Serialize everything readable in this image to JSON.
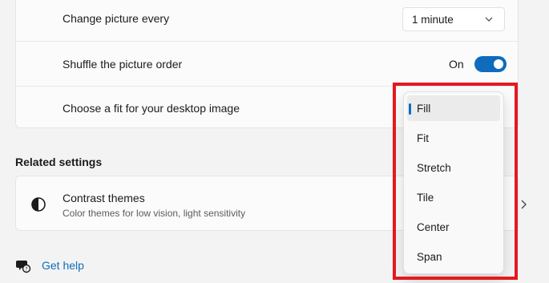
{
  "settings": {
    "change_picture": {
      "label": "Change picture every",
      "value": "1 minute"
    },
    "shuffle": {
      "label": "Shuffle the picture order",
      "state_text": "On"
    },
    "fit": {
      "label": "Choose a fit for your desktop image"
    }
  },
  "fit_options": [
    "Fill",
    "Fit",
    "Stretch",
    "Tile",
    "Center",
    "Span"
  ],
  "selected_fit": "Fill",
  "related": {
    "title": "Related settings",
    "contrast": {
      "title": "Contrast themes",
      "subtitle": "Color themes for low vision, light sensitivity"
    }
  },
  "help": {
    "label": "Get help"
  },
  "colors": {
    "accent": "#0f6cbd",
    "highlight": "#e3191f"
  }
}
